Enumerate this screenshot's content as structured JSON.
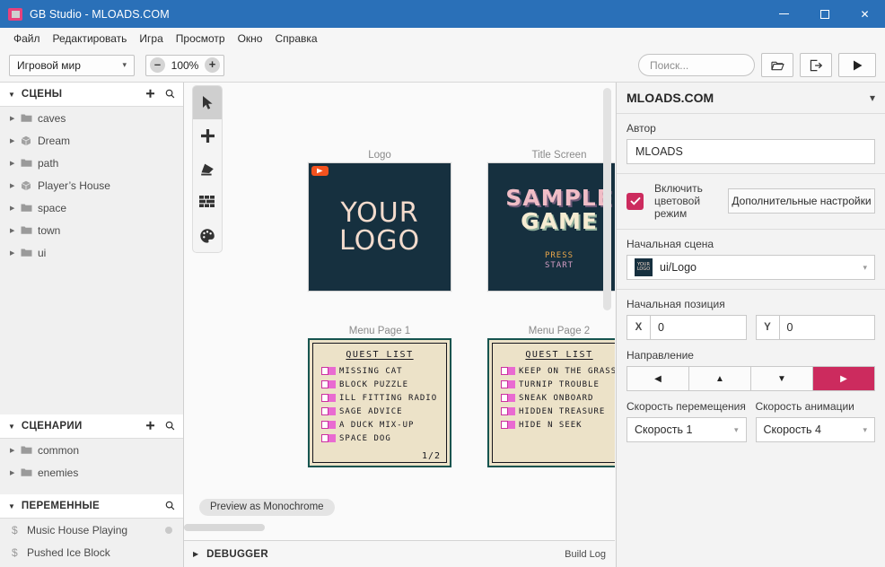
{
  "window": {
    "title": "GB Studio - MLOADS.COM",
    "app_icon": "gbstudio-icon",
    "titlebar_color": "#2a70b8",
    "minimize": "—",
    "maximize": "□",
    "close": "✕"
  },
  "menubar": {
    "items": [
      {
        "label": "Файл"
      },
      {
        "label": "Редактировать"
      },
      {
        "label": "Игра"
      },
      {
        "label": "Просмотр"
      },
      {
        "label": "Окно"
      },
      {
        "label": "Справка"
      }
    ]
  },
  "toolbar": {
    "world_select_value": "Игровой мир",
    "world_select_options": [
      "Игровой мир"
    ],
    "zoom_out": "–",
    "zoom_value": "100%",
    "zoom_in": "+",
    "search_placeholder": "Поиск...",
    "search_value": "",
    "open_project_icon": "folder-icon",
    "export_icon": "export-icon",
    "run_icon": "play-icon"
  },
  "sidebar": {
    "scenes": {
      "title": "СЦЕНЫ",
      "add_icon": "plus-icon",
      "search_icon": "search-icon",
      "expanded": true,
      "items": [
        {
          "label": "caves",
          "icon": "folder-icon"
        },
        {
          "label": "Dream",
          "icon": "scene-cube-icon"
        },
        {
          "label": "path",
          "icon": "folder-icon"
        },
        {
          "label": "Player’s House",
          "icon": "scene-cube-icon"
        },
        {
          "label": "space",
          "icon": "folder-icon"
        },
        {
          "label": "town",
          "icon": "folder-icon"
        },
        {
          "label": "ui",
          "icon": "folder-icon"
        }
      ]
    },
    "scripts": {
      "title": "СЦЕНАРИИ",
      "add_icon": "plus-icon",
      "search_icon": "search-icon",
      "expanded": true,
      "items": [
        {
          "label": "common",
          "icon": "folder-icon"
        },
        {
          "label": "enemies",
          "icon": "folder-icon"
        }
      ]
    },
    "variables": {
      "title": "ПЕРЕМЕННЫЕ",
      "search_icon": "search-icon",
      "expanded": true,
      "items": [
        {
          "label": "Music House Playing",
          "icon": "variable-dollar-icon",
          "has_dot": true
        },
        {
          "label": "Pushed Ice Block",
          "icon": "variable-dollar-icon",
          "has_dot": false
        }
      ]
    }
  },
  "tools": {
    "items": [
      {
        "name": "select-tool",
        "icon": "cursor-icon",
        "active": true
      },
      {
        "name": "add-tool",
        "icon": "plus-icon",
        "active": false
      },
      {
        "name": "eraser-tool",
        "icon": "eraser-icon",
        "active": false
      },
      {
        "name": "collisions-tool",
        "icon": "bricks-icon",
        "active": false
      },
      {
        "name": "palette-tool",
        "icon": "palette-icon",
        "active": false
      }
    ]
  },
  "canvas": {
    "preview_monochrome_label": "Preview as Monochrome",
    "scenes": [
      {
        "name": "logo-scene",
        "label": "Logo",
        "has_start_flag": true,
        "bg_color": "#16303f",
        "text_color": "#f3dbcd",
        "lines": [
          "YOUR",
          "LOGO"
        ]
      },
      {
        "name": "title-screen-scene",
        "label": "Title Screen",
        "has_start_flag": false,
        "bg_color": "#16303f",
        "title_line1": "SAMPLE",
        "title_line2": "GAME",
        "press_line1": "PRESS",
        "press_line2": "START"
      },
      {
        "name": "menu-page-1-scene",
        "label": "Menu Page 1",
        "bg_color": "#ece2c8",
        "border_color": "#16544f",
        "header": "QUEST LIST",
        "page_indicator": "1/2",
        "quests": [
          "MISSING CAT",
          "BLOCK PUZZLE",
          "ILL FITTING RADIO",
          "SAGE ADVICE",
          "A DUCK MIX-UP",
          "SPACE DOG"
        ]
      },
      {
        "name": "menu-page-2-scene",
        "label": "Menu Page 2",
        "bg_color": "#ece2c8",
        "border_color": "#16544f",
        "header": "QUEST LIST",
        "page_indicator": "",
        "quests": [
          "KEEP ON THE GRASS",
          "TURNIP TROUBLE",
          "SNEAK ONBOARD",
          "HIDDEN TREASURE",
          "HIDE N SEEK"
        ]
      }
    ]
  },
  "footer": {
    "debugger_label": "DEBUGGER",
    "build_log_label": "Build Log",
    "expand_icon": "triangle-right-icon"
  },
  "right_panel": {
    "title": "MLOADS.COM",
    "collapse_icon": "chevron-down-icon",
    "author_label": "Автор",
    "author_value": "MLOADS",
    "author_placeholder": "",
    "color_mode_label": "Включить цветовой режим",
    "color_mode_checked": true,
    "settings_button": "Дополнительные настройки",
    "start_scene_label": "Начальная сцена",
    "start_scene_value": "ui/Logo",
    "start_pos_label": "Начальная позиция",
    "x_key": "X",
    "x_value": "0",
    "y_key": "Y",
    "y_value": "0",
    "direction_label": "Направление",
    "directions": [
      {
        "name": "direction-left",
        "glyph": "◀",
        "selected": false
      },
      {
        "name": "direction-up",
        "glyph": "▲",
        "selected": false
      },
      {
        "name": "direction-down",
        "glyph": "▼",
        "selected": false
      },
      {
        "name": "direction-right",
        "glyph": "▶",
        "selected": true
      }
    ],
    "move_speed_label": "Скорость перемещения",
    "move_speed_value": "Скорость 1",
    "anim_speed_label": "Скорость анимации",
    "anim_speed_value": "Скорость 4",
    "accent_color": "#cc2b5e"
  }
}
